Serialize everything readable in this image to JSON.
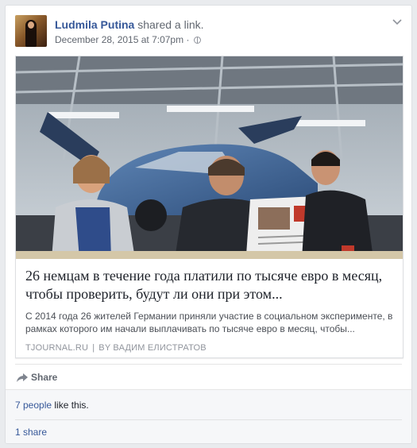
{
  "post": {
    "author": "Ludmila Putina",
    "action": "shared a link.",
    "timestamp": "December 28, 2015 at 7:07pm",
    "separator": "·",
    "privacy_icon": "globe-icon",
    "menu_icon": "chevron-down-icon"
  },
  "link": {
    "title": "26 немцам в течение года платили по тысяче евро в месяц, чтобы проверить, будут ли они при этом...",
    "description": "С 2014 года 26 жителей Германии приняли участие в социальном эксперименте, в рамках которого им начали выплачивать по тысяче евро в месяц, чтобы...",
    "source": "TJOURNAL.RU",
    "source_separator": "|",
    "author": "BY ВАДИМ ЕЛИСТРАТОВ"
  },
  "actions": {
    "share_label": "Share",
    "share_icon": "share-arrow-icon"
  },
  "feedback": {
    "likes_count": "7 people",
    "likes_suffix": " like this.",
    "shares": "1 share"
  },
  "colors": {
    "link_blue": "#365899",
    "meta_gray": "#616770",
    "feedback_bg": "#f6f7f9"
  }
}
